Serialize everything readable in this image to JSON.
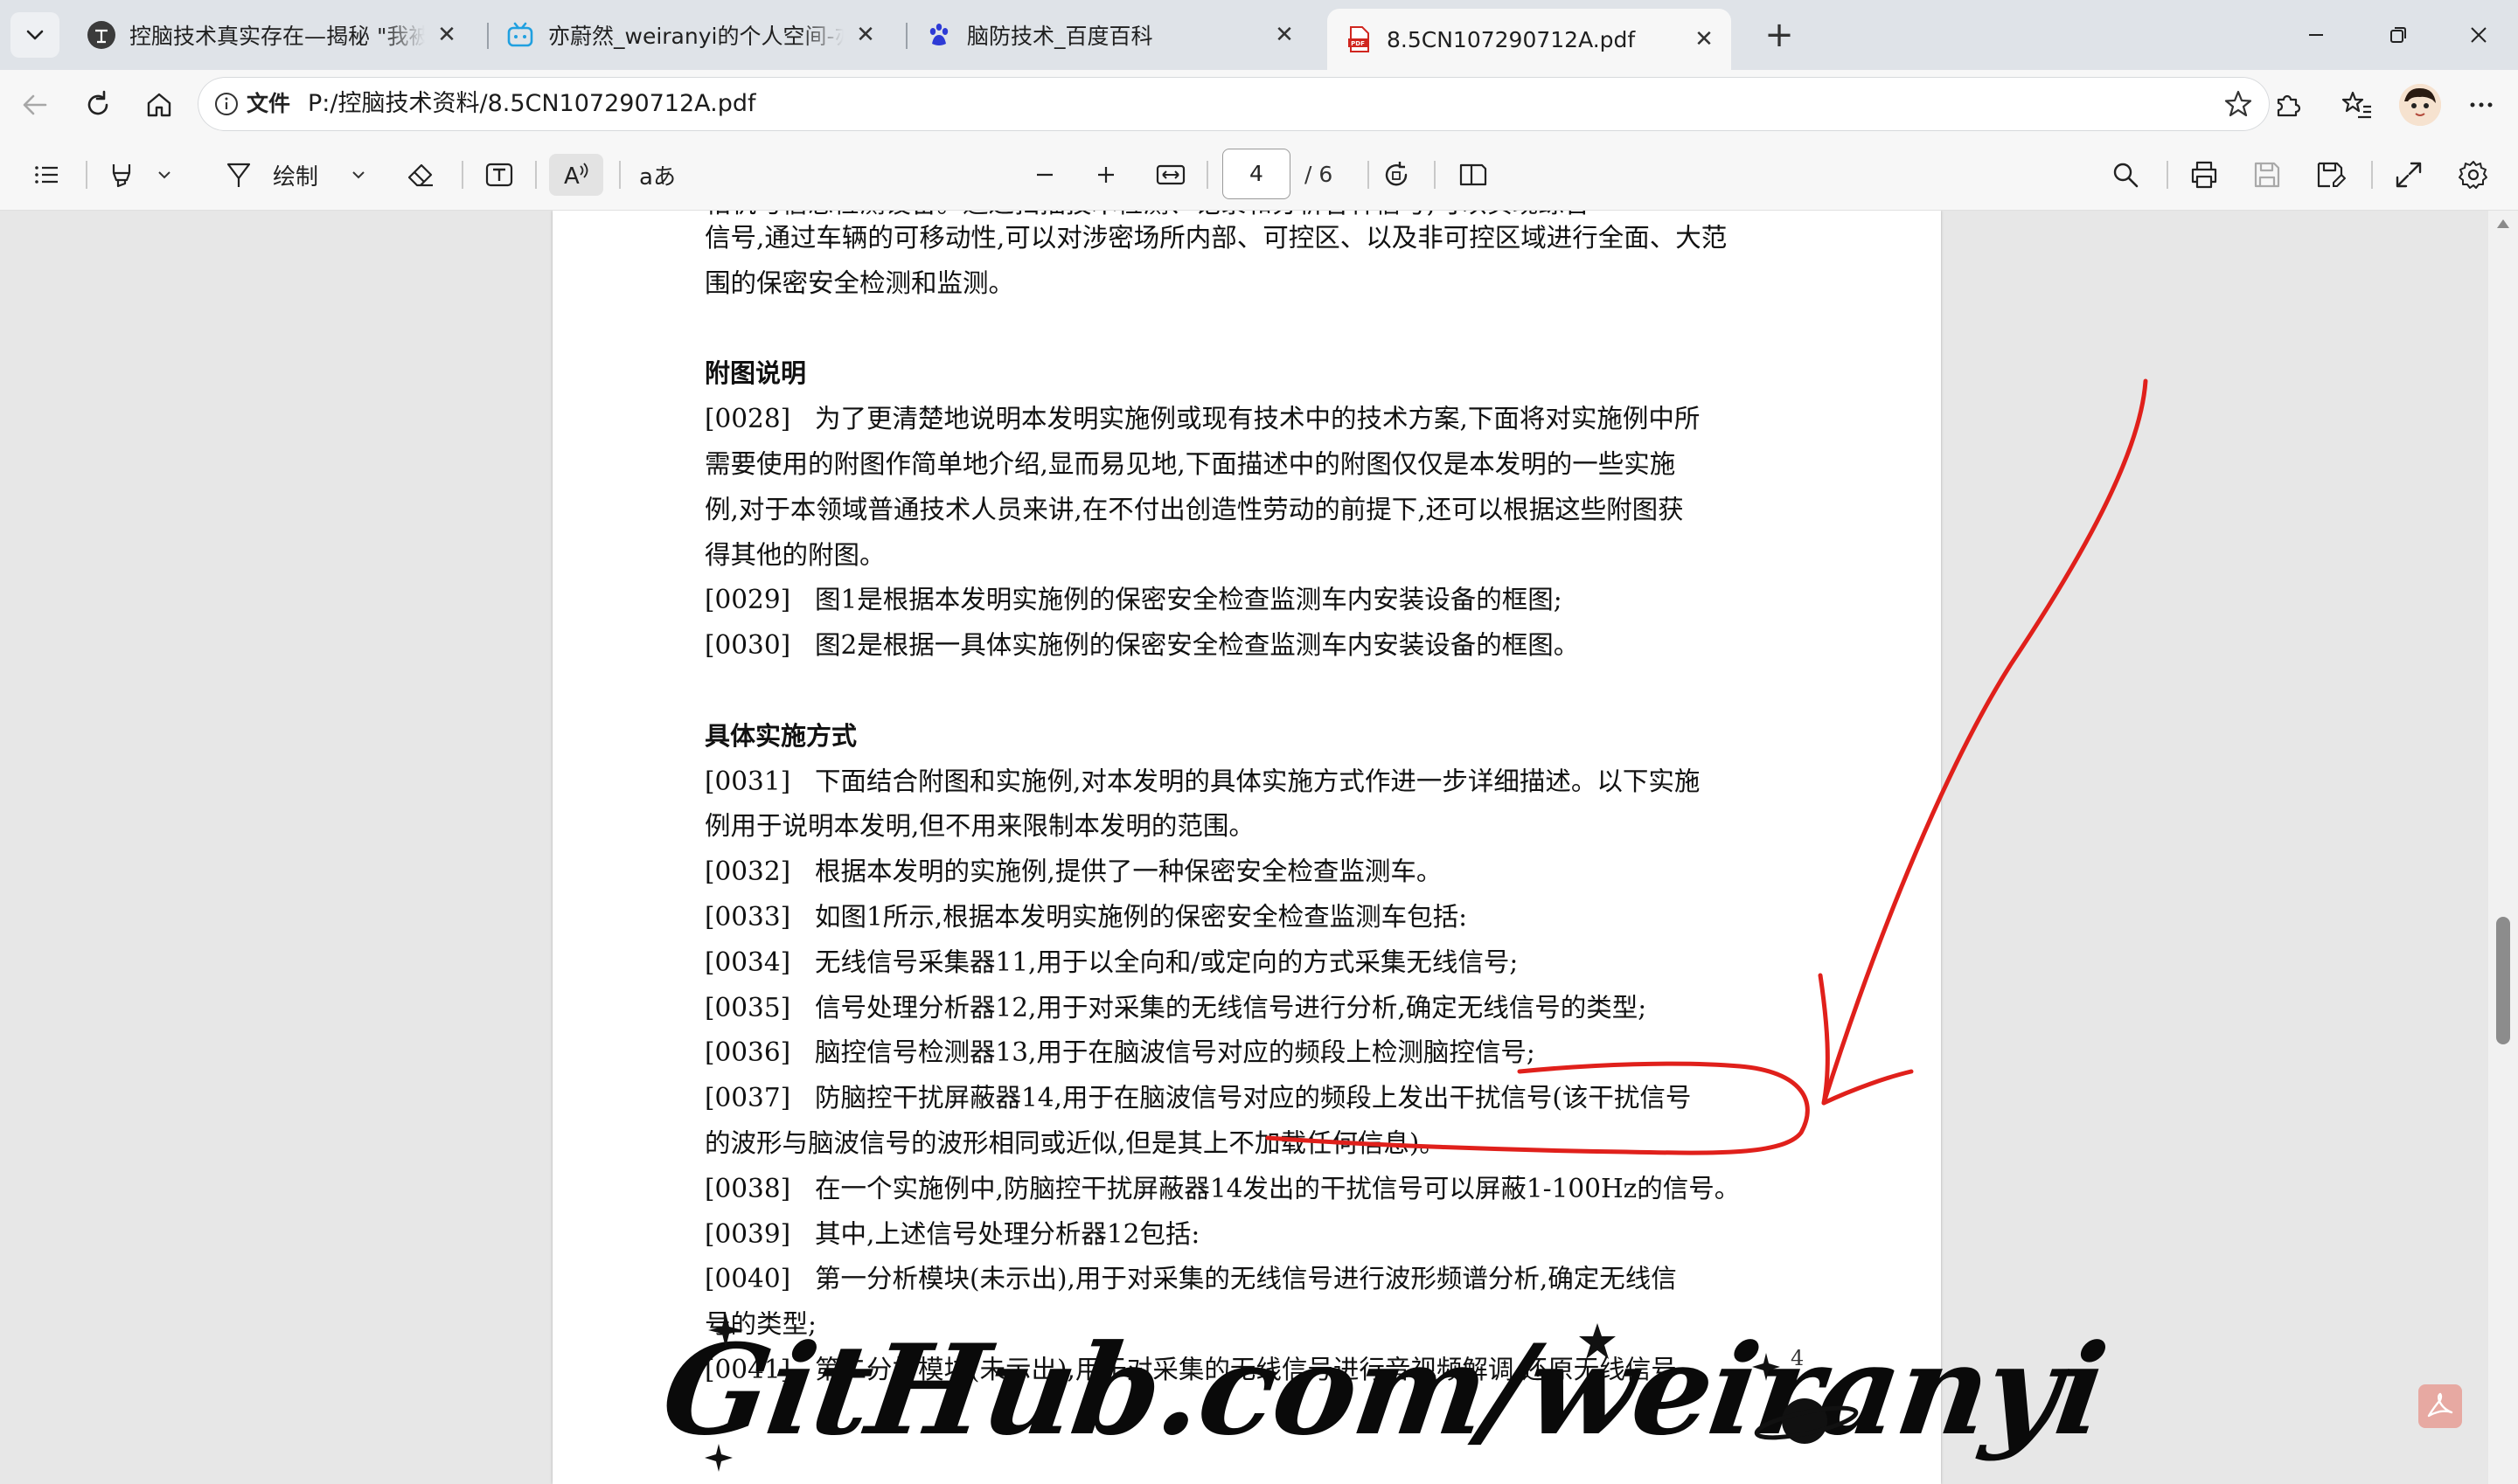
{
  "tabs": [
    {
      "title": "控脑技术真实存在—揭秘 \"我被脑控了\"",
      "icon": "zhihu-style-avatar-icon",
      "active": false
    },
    {
      "title": "亦蔚然_weiranyi的个人空间-亦蔚然",
      "icon": "bilibili-icon",
      "active": false
    },
    {
      "title": "脑防技术_百度百科",
      "icon": "baidu-paw-icon",
      "active": false
    },
    {
      "title": "8.5CN107290712A.pdf",
      "icon": "pdf-file-icon",
      "active": true
    }
  ],
  "address": {
    "chip": "文件",
    "url": "P:/控脑技术资料/8.5CN107290712A.pdf"
  },
  "pdf_toolbar": {
    "draw_label": "绘制",
    "read_aloud_glyph": "A",
    "translate_glyph": "aあ",
    "current_page": "4",
    "total_pages": "/ 6"
  },
  "document": {
    "top_cut_line": "相机与信息检测设备。通过扫描技术检测、记录和分析各种信号,可以实现综合",
    "lines": [
      {
        "pn": "",
        "text": "信号,通过车辆的可移动性,可以对涉密场所内部、可控区、以及非可控区域进行全面、大范"
      },
      {
        "pn": "",
        "text": "围的保密安全检测和监测。"
      },
      {
        "pn": "",
        "text": ""
      },
      {
        "pn": "",
        "text": "附图说明",
        "heading": true
      },
      {
        "pn": "[0028]",
        "text": "为了更清楚地说明本发明实施例或现有技术中的技术方案,下面将对实施例中所"
      },
      {
        "pn": "",
        "text": "需要使用的附图作简单地介绍,显而易见地,下面描述中的附图仅仅是本发明的一些实施"
      },
      {
        "pn": "",
        "text": "例,对于本领域普通技术人员来讲,在不付出创造性劳动的前提下,还可以根据这些附图获"
      },
      {
        "pn": "",
        "text": "得其他的附图。"
      },
      {
        "pn": "[0029]",
        "text": "图1是根据本发明实施例的保密安全检查监测车内安装设备的框图;"
      },
      {
        "pn": "[0030]",
        "text": "图2是根据一具体实施例的保密安全检查监测车内安装设备的框图。"
      },
      {
        "pn": "",
        "text": ""
      },
      {
        "pn": "",
        "text": "具体实施方式",
        "heading": true
      },
      {
        "pn": "[0031]",
        "text": "下面结合附图和实施例,对本发明的具体实施方式作进一步详细描述。以下实施"
      },
      {
        "pn": "",
        "text": "例用于说明本发明,但不用来限制本发明的范围。"
      },
      {
        "pn": "[0032]",
        "text": "根据本发明的实施例,提供了一种保密安全检查监测车。"
      },
      {
        "pn": "[0033]",
        "text": "如图1所示,根据本发明实施例的保密安全检查监测车包括:"
      },
      {
        "pn": "[0034]",
        "text": "无线信号采集器11,用于以全向和/或定向的方式采集无线信号;"
      },
      {
        "pn": "[0035]",
        "text": "信号处理分析器12,用于对采集的无线信号进行分析,确定无线信号的类型;"
      },
      {
        "pn": "[0036]",
        "text": "脑控信号检测器13,用于在脑波信号对应的频段上检测脑控信号;"
      },
      {
        "pn": "[0037]",
        "text": "防脑控干扰屏蔽器14,用于在脑波信号对应的频段上发出干扰信号(该干扰信号"
      },
      {
        "pn": "",
        "text": "的波形与脑波信号的波形相同或近似,但是其上不加载任何信息)。"
      },
      {
        "pn": "[0038]",
        "text": "在一个实施例中,防脑控干扰屏蔽器14发出的干扰信号可以屏蔽1-100Hz的信号。"
      },
      {
        "pn": "[0039]",
        "text": "其中,上述信号处理分析器12包括:"
      },
      {
        "pn": "[0040]",
        "text": "第一分析模块(未示出),用于对采集的无线信号进行波形频谱分析,确定无线信"
      },
      {
        "pn": "",
        "text": "号的类型;"
      },
      {
        "pn": "[0041]",
        "text": "第二分析模块(未示出),用于对采集的无线信号进行音视频解调,还原无线信号"
      }
    ],
    "page_number": "4"
  },
  "watermark": "GitHub.com/weiranyi",
  "colors": {
    "annotation_red": "#e0201b",
    "tabstrip": "#dfe3e8",
    "toolbar": "#f7f7f7",
    "viewer_bg": "#e7e7e7"
  }
}
